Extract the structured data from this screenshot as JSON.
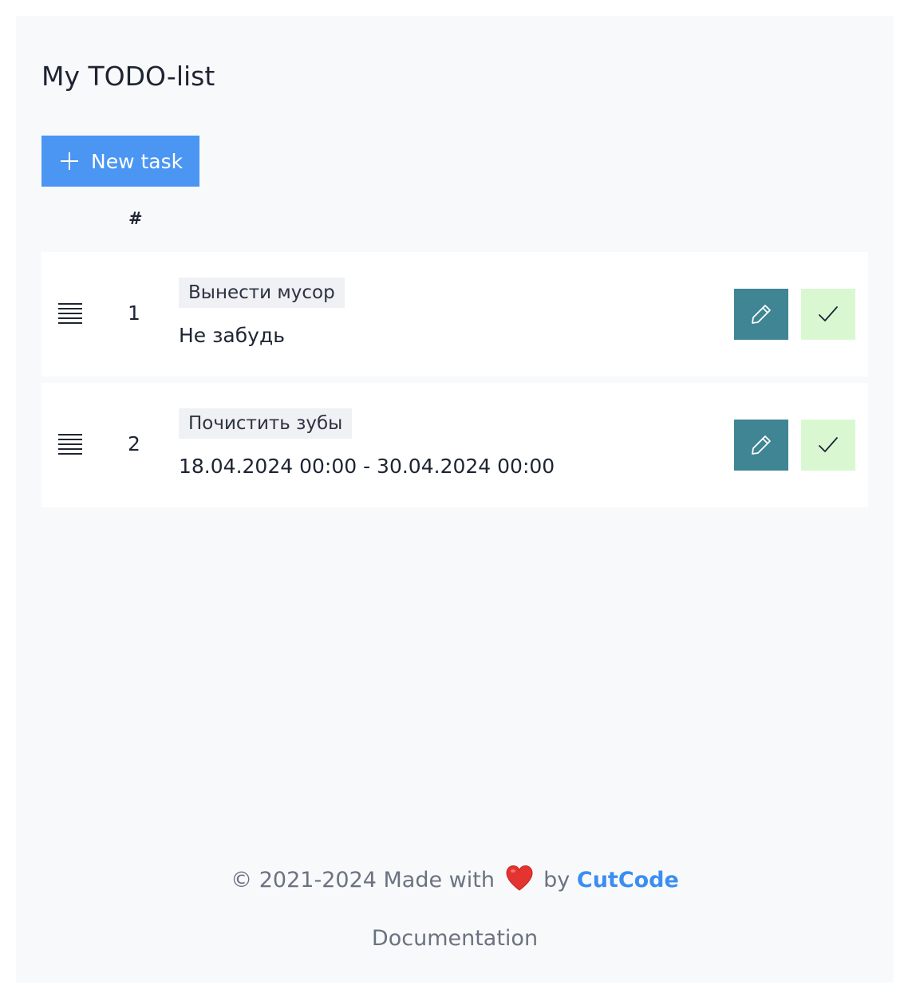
{
  "header": {
    "title": "My TODO-list"
  },
  "toolbar": {
    "new_task_label": "New task",
    "new_task_icon": "plus-icon"
  },
  "table": {
    "index_header": "#"
  },
  "tasks": [
    {
      "index": "1",
      "title": "Вынести мусор",
      "detail": "Не забудь"
    },
    {
      "index": "2",
      "title": "Почистить зубы",
      "detail": "18.04.2024 00:00 - 30.04.2024 00:00"
    }
  ],
  "actions": {
    "edit_icon": "pencil-icon",
    "complete_icon": "checkmark-icon",
    "drag_icon": "drag-handle-icon"
  },
  "footer": {
    "copyright_prefix": "© 2021-2024 Made with",
    "by_text": "by",
    "brand": "CutCode",
    "heart_icon": "heart-icon",
    "documentation_label": "Documentation"
  },
  "colors": {
    "primary": "#4a96f2",
    "edit_button": "#3f8593",
    "done_button": "#d9f8d2",
    "brand_link": "#3b8ef0",
    "page_background": "#f8f9fb"
  }
}
